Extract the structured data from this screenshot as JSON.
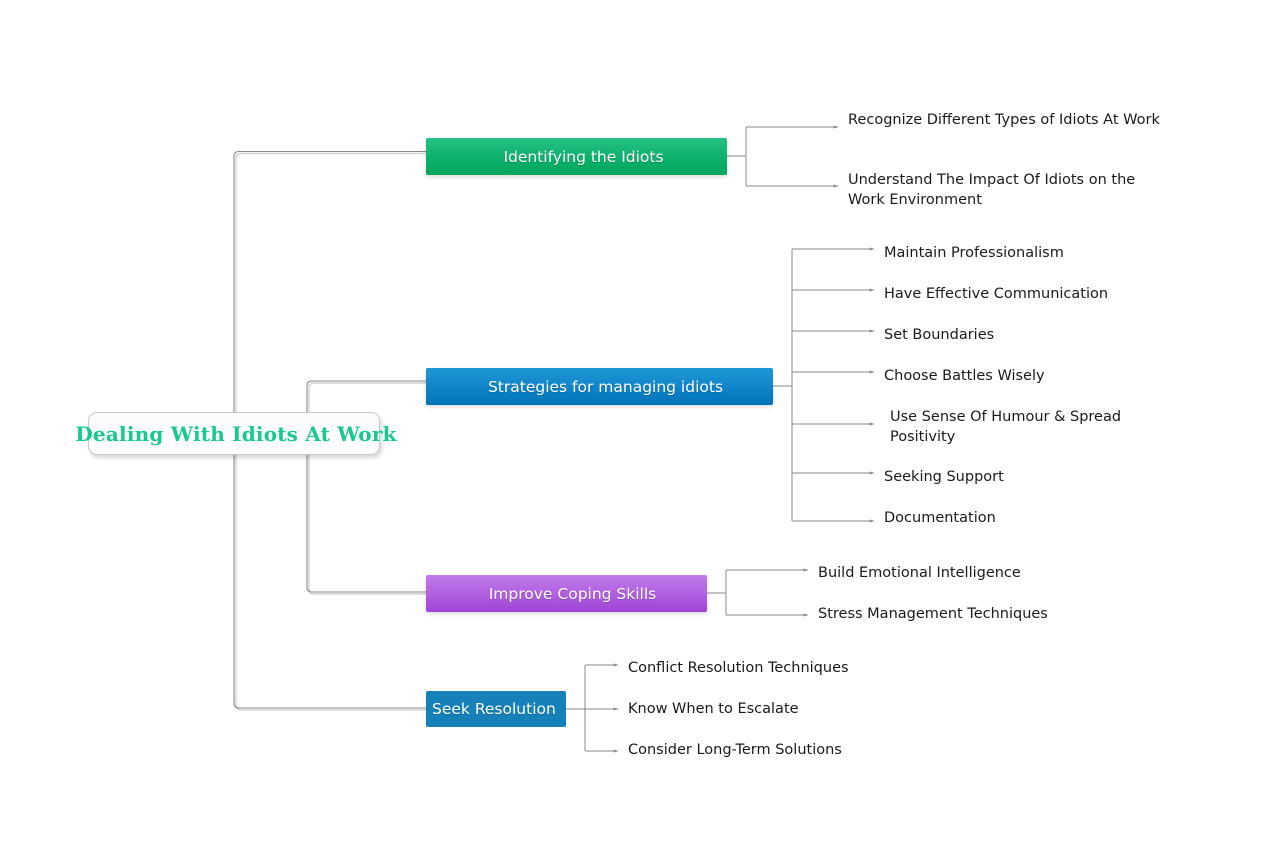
{
  "diagram": {
    "type": "mind-map",
    "background": "#ffffff",
    "center": {
      "label": "Dealing With Idiots At Work",
      "text_color": "#16c98d",
      "background": "#fcfcfc",
      "border_color": "#c9c9c9"
    },
    "branches": [
      {
        "label": "Identifying the Idiots",
        "color": "#00a65a",
        "color_top": "#25c183",
        "text_color": "#ffffff",
        "children": [
          "Recognize Different Types of Idiots At Work",
          "Understand The Impact Of Idiots on the Work Environment"
        ]
      },
      {
        "label": "Strategies for managing idiots",
        "color": "#0073b9",
        "color_top": "#1e97d6",
        "text_color": "#ffffff",
        "children": [
          "Maintain Professionalism",
          "Have Effective Communication",
          "Set Boundaries",
          "Choose Battles Wisely",
          "Use Sense Of Humour & Spread Positivity",
          "Seeking Support",
          "Documentation"
        ]
      },
      {
        "label": "Improve Coping Skills",
        "color": "#9f44d6",
        "color_top": "#c07de8",
        "text_color": "#ffffff",
        "children": [
          "Build Emotional Intelligence",
          "Stress Management Techniques"
        ]
      },
      {
        "label": "Seek Resolution",
        "color": "#1681b8",
        "color_top": "#1681b8",
        "text_color": "#ffffff",
        "children": [
          "Conflict Resolution Techniques",
          "Know When to Escalate",
          "Consider Long-Term Solutions"
        ]
      }
    ],
    "connector_color": "#8a8a8a",
    "connector_shadow_color": "#cfcfcf"
  }
}
